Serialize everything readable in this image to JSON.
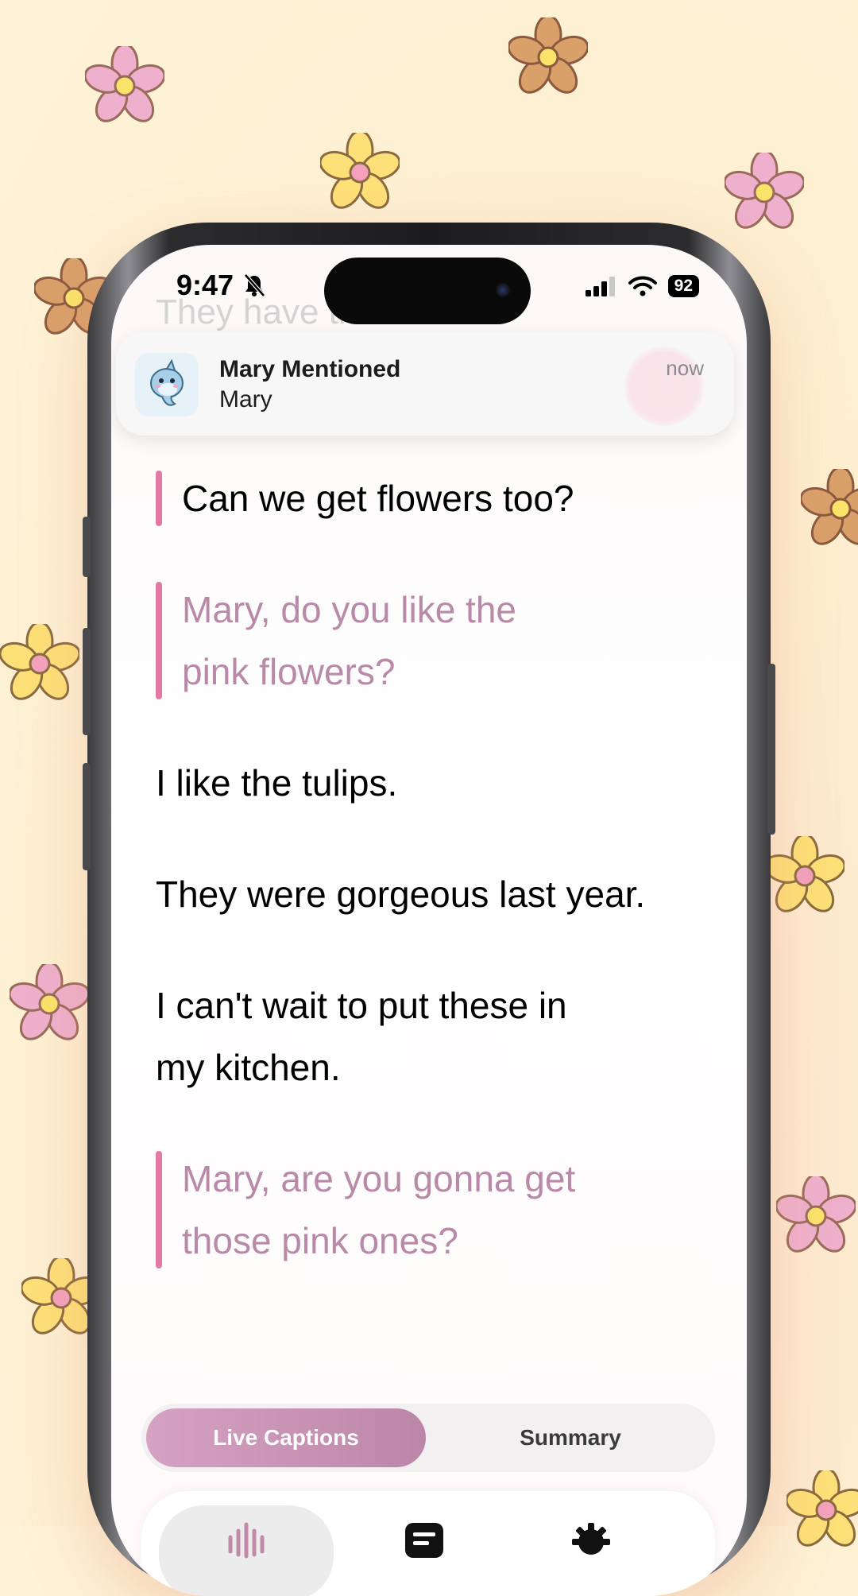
{
  "status_bar": {
    "time": "9:47",
    "battery": "92"
  },
  "background_text": "They have the best",
  "notification": {
    "title": "Mary Mentioned",
    "subtitle": "Mary",
    "time": "now"
  },
  "captions": [
    {
      "text": "Can we get flowers too?",
      "style": "bar"
    },
    {
      "text": "Mary, do you like the pink flowers?",
      "style": "mention"
    },
    {
      "text": "I like the tulips.",
      "style": "plain"
    },
    {
      "text": "They were gorgeous last year.",
      "style": "plain"
    },
    {
      "text": "I can't wait to put these in my kitchen.",
      "style": "plain"
    },
    {
      "text": "Mary, are you gonna get those pink ones?",
      "style": "mention"
    }
  ],
  "segmented_control": {
    "live_label": "Live Captions",
    "summary_label": "Summary"
  },
  "colors": {
    "accent_pink": "#e27aa3",
    "mention_text": "#b98aa8",
    "background": "#fef3d8"
  }
}
